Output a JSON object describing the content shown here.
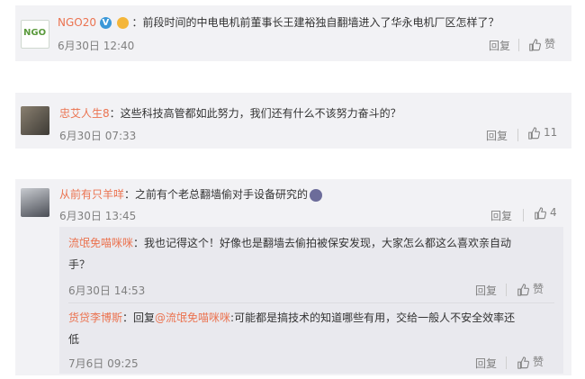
{
  "comments": [
    {
      "user": "NGO20",
      "text": "：前段时间的中电电机前董事长王建裕独自翻墙进入了华永电机厂区怎样了？",
      "date": "6月30日 12:40",
      "reply_label": "回复",
      "like_label": "赞",
      "avatar_text": "NGO"
    },
    {
      "user": "忠艾人生8",
      "text": "：这些科技高管都如此努力，我们还有什么不该努力奋斗的？",
      "date": "6月30日 07:33",
      "reply_label": "回复",
      "like_count": "11"
    },
    {
      "user": "从前有只羊咩",
      "text": "：之前有个老总翻墙偷对手设备研究的",
      "date": "6月30日 13:45",
      "reply_label": "回复",
      "like_count": "4",
      "replies": [
        {
          "user": "流氓免喵咪咪",
          "text_line1": "：我也记得这个！好像也是翻墙去偷拍被保安发现，大家怎么都这么喜欢亲自动",
          "text_line2": "手？",
          "date": "6月30日 14:53",
          "reply_label": "回复",
          "like_label": "赞"
        },
        {
          "user": "货贷李博斯",
          "prefix": "：回复",
          "mention": "@流氓免喵咪咪",
          "text_line1": ":可能都是搞技术的知道哪些有用，交给一般人不安全效率还",
          "text_line2": "低",
          "date": "7月6日 09:25",
          "reply_label": "回复",
          "like_label": "赞"
        }
      ]
    }
  ],
  "colors": {
    "username": "#eb7350",
    "card": "#f2f2f5",
    "reply_box": "#e9e9ee",
    "meta": "#808080"
  },
  "icons": [
    "thumb-up-icon",
    "verified-badge-icon",
    "medal-icon",
    "emoji-icon"
  ]
}
